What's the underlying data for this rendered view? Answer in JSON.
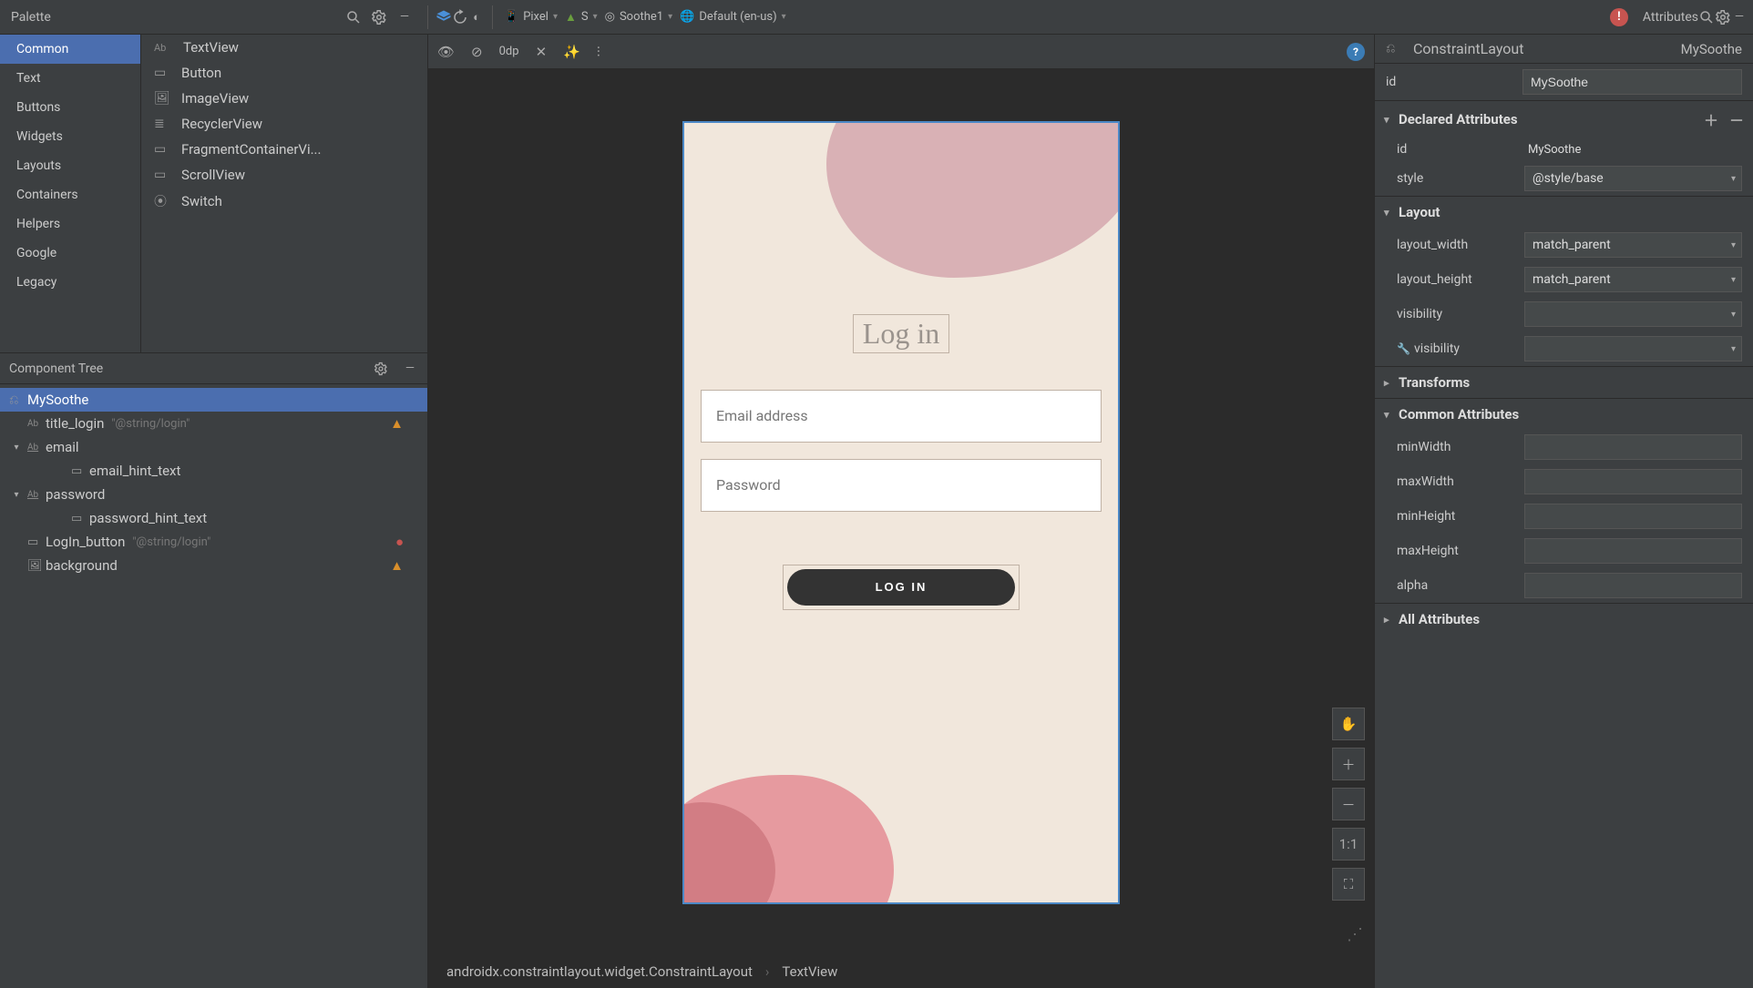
{
  "topbar": {
    "device": "Pixel",
    "api": "S",
    "theme": "Soothe1",
    "locale": "Default (en-us)"
  },
  "palette": {
    "title": "Palette",
    "categories": [
      "Common",
      "Text",
      "Buttons",
      "Widgets",
      "Layouts",
      "Containers",
      "Helpers",
      "Google",
      "Legacy"
    ],
    "items": [
      {
        "icon": "Ab",
        "label": "TextView"
      },
      {
        "icon": "▭",
        "label": "Button"
      },
      {
        "icon": "🖼",
        "label": "ImageView"
      },
      {
        "icon": "≣",
        "label": "RecyclerView"
      },
      {
        "icon": "▭",
        "label": "FragmentContainerVi..."
      },
      {
        "icon": "▭",
        "label": "ScrollView"
      },
      {
        "icon": "⦿",
        "label": "Switch"
      }
    ]
  },
  "componentTree": {
    "title": "Component Tree",
    "nodes": {
      "root": "MySoothe",
      "title_login": "title_login",
      "title_login_extra": "\"@string/login\"",
      "email": "email",
      "email_hint": "email_hint_text",
      "password": "password",
      "password_hint": "password_hint_text",
      "login_btn": "LogIn_button",
      "login_btn_extra": "\"@string/login\"",
      "background": "background"
    }
  },
  "designToolbar": {
    "dp": "0dp"
  },
  "preview": {
    "title": "Log in",
    "email_placeholder": "Email address",
    "password_placeholder": "Password",
    "button": "LOG IN"
  },
  "surfaceTools": {
    "fit": "1:1"
  },
  "breadcrumb": {
    "a": "androidx.constraintlayout.widget.ConstraintLayout",
    "b": "TextView"
  },
  "attributes": {
    "title": "Attributes",
    "componentType": "ConstraintLayout",
    "componentName": "MySoothe",
    "id_label": "id",
    "id_value": "MySoothe",
    "declared": {
      "title": "Declared Attributes",
      "id_label": "id",
      "id_value": "MySoothe",
      "style_label": "style",
      "style_value": "@style/base"
    },
    "layout": {
      "title": "Layout",
      "lw_label": "layout_width",
      "lw": "match_parent",
      "lh_label": "layout_height",
      "lh": "match_parent",
      "vis_label": "visibility",
      "vis2_label": "visibility"
    },
    "transforms": "Transforms",
    "common": {
      "title": "Common Attributes",
      "minW": "minWidth",
      "maxW": "maxWidth",
      "minH": "minHeight",
      "maxH": "maxHeight",
      "alpha": "alpha"
    },
    "all": "All Attributes"
  }
}
